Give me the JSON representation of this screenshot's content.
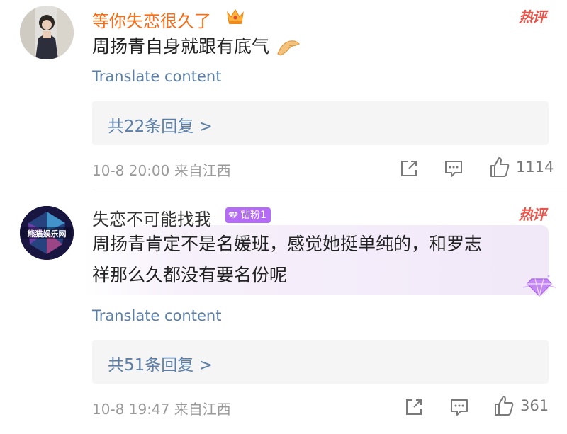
{
  "comments": [
    {
      "username": "等你失恋很久了",
      "text": "周扬青自身就跟有底气",
      "hot_label": "热评",
      "translate_label": "Translate content",
      "replies_label": "共22条回复 >",
      "meta": "10-8 20:00 来自江西",
      "likes": "1114",
      "badge_icon": "crown-icon",
      "emoji": "pinching-hand-emoji"
    },
    {
      "username": "失恋不可能找我",
      "fan_badge": "钻粉1",
      "avatar_label": "熊猫娱乐网",
      "text_line1": "周扬青肯定不是名媛班，感觉她挺单纯的，和罗志",
      "text_line2": "祥那么久都没有要名份呢",
      "hot_label": "热评",
      "translate_label": "Translate content",
      "replies_label": "共51条回复 >",
      "meta": "10-8 19:47 来自江西",
      "likes": "361"
    }
  ],
  "colors": {
    "username_vip": "#f46e19",
    "link_blue": "#5b7fa8",
    "hot_red": "#e8534a",
    "fan_purple": "#b46cf5"
  }
}
